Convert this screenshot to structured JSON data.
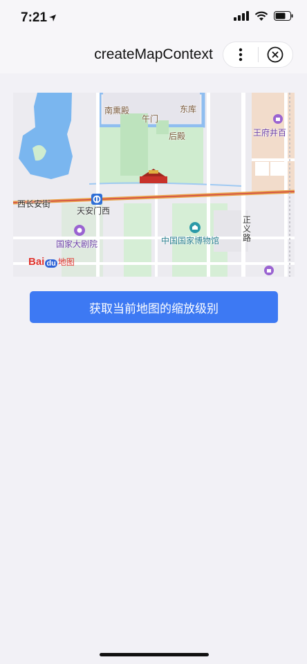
{
  "status_bar": {
    "time": "7:21",
    "icons": [
      "location-arrow-icon",
      "cellular-signal-icon",
      "wifi-icon",
      "battery-icon"
    ]
  },
  "nav": {
    "title": "createMapContext",
    "capsule_icons": [
      "more-icon",
      "close-icon"
    ]
  },
  "map": {
    "labels": {
      "nanxundian": "南熏殿",
      "wumen": "午门",
      "dongku": "东库",
      "houdian": "后殿",
      "wangfujing": "王府井百",
      "xichanganjie": "西长安街",
      "tiananmenxi": "天安门西",
      "zhengyilu_1": "正",
      "zhengyilu_2": "义",
      "zhengyilu_3": "路",
      "grand_theatre": "国家大剧院",
      "national_museum": "中国国家博物馆",
      "baidu_logo_left": "Bai",
      "baidu_logo_mid": "du",
      "baidu_logo_right": "地图"
    },
    "colors": {
      "water": "#7ab6ef",
      "park": "#cfeccf",
      "road_main": "#e9a24a",
      "building": "#f2dccb",
      "palace_wall": "#8fbef0"
    }
  },
  "action_button": {
    "label": "获取当前地图的缩放级别"
  }
}
